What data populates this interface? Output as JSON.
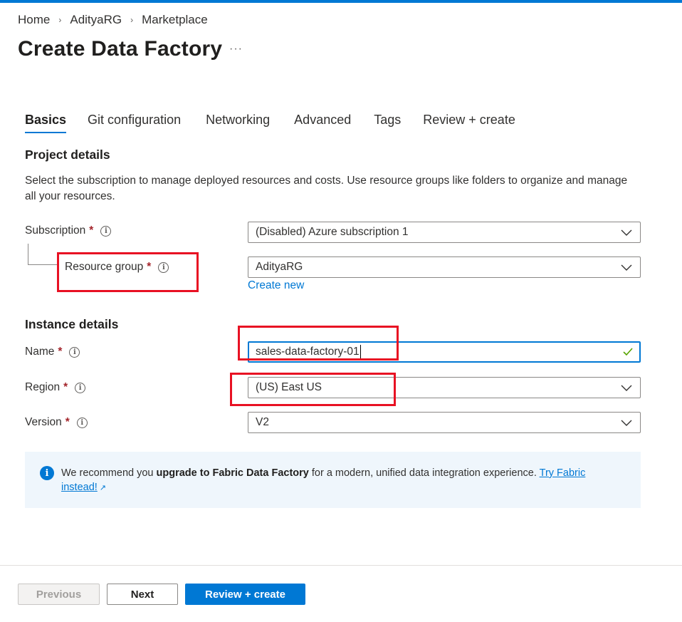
{
  "colors": {
    "accent": "#0078d4",
    "required": "#a4262c",
    "highlight": "#e81123",
    "banner_bg": "#eff6fc"
  },
  "breadcrumb": [
    "Home",
    "AdityaRG",
    "Marketplace"
  ],
  "page": {
    "title": "Create Data Factory",
    "more": "···"
  },
  "tabs": [
    {
      "label": "Basics",
      "active": true
    },
    {
      "label": "Git configuration",
      "active": false
    },
    {
      "label": "Networking",
      "active": false
    },
    {
      "label": "Advanced",
      "active": false
    },
    {
      "label": "Tags",
      "active": false
    },
    {
      "label": "Review + create",
      "active": false
    }
  ],
  "project": {
    "title": "Project details",
    "description": "Select the subscription to manage deployed resources and costs. Use resource groups like folders to organize and manage all your resources.",
    "subscription": {
      "label": "Subscription",
      "value": "(Disabled) Azure subscription 1"
    },
    "resource_group": {
      "label": "Resource group",
      "value": "AdityaRG",
      "create_new": "Create new"
    }
  },
  "instance": {
    "title": "Instance details",
    "name": {
      "label": "Name",
      "value": "sales-data-factory-01"
    },
    "region": {
      "label": "Region",
      "value": "(US) East US"
    },
    "version": {
      "label": "Version",
      "value": "V2"
    }
  },
  "banner": {
    "icon": "info-icon",
    "prefix": "We recommend you ",
    "bold": "upgrade to Fabric Data Factory",
    "suffix": " for a modern, unified data integration experience. ",
    "link": "Try Fabric instead!"
  },
  "footer": {
    "previous": "Previous",
    "next": "Next",
    "review": "Review + create"
  }
}
